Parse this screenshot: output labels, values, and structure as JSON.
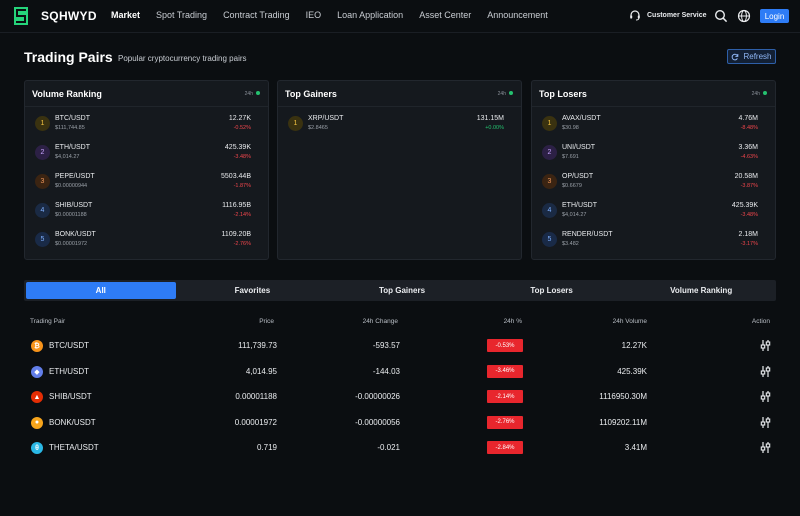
{
  "brand": {
    "name": "SQHWYD",
    "accent": "#2e7cf6"
  },
  "nav": {
    "links": [
      "Market",
      "Spot Trading",
      "Contract Trading",
      "IEO",
      "Loan Application",
      "Asset Center",
      "Announcement"
    ],
    "customer_service": "Customer Service",
    "login_label": "Login"
  },
  "header": {
    "title": "Trading Pairs",
    "subtitle": "Popular cryptocurrency trading pairs",
    "refresh_label": "Refresh"
  },
  "cards": [
    {
      "title": "Volume Ranking",
      "period": "24h",
      "items": [
        {
          "rank": "1",
          "symbol": "BTC/USDT",
          "price": "$111,744.85",
          "value": "12.27K",
          "change": "-0.52%",
          "dir": "neg"
        },
        {
          "rank": "2",
          "symbol": "ETH/USDT",
          "price": "$4,014.27",
          "value": "425.39K",
          "change": "-3.48%",
          "dir": "neg"
        },
        {
          "rank": "3",
          "symbol": "PEPE/USDT",
          "price": "$0.00000944",
          "value": "5503.44B",
          "change": "-1.87%",
          "dir": "neg"
        },
        {
          "rank": "4",
          "symbol": "SHIB/USDT",
          "price": "$0.00001188",
          "value": "1116.95B",
          "change": "-2.14%",
          "dir": "neg"
        },
        {
          "rank": "5",
          "symbol": "BONK/USDT",
          "price": "$0.00001972",
          "value": "1109.20B",
          "change": "-2.76%",
          "dir": "neg"
        }
      ]
    },
    {
      "title": "Top Gainers",
      "period": "24h",
      "items": [
        {
          "rank": "1",
          "symbol": "XRP/USDT",
          "price": "$2.8465",
          "value": "131.15M",
          "change": "+0.00%",
          "dir": "pos"
        }
      ]
    },
    {
      "title": "Top Losers",
      "period": "24h",
      "items": [
        {
          "rank": "1",
          "symbol": "AVAX/USDT",
          "price": "$30.98",
          "value": "4.76M",
          "change": "-8.48%",
          "dir": "neg"
        },
        {
          "rank": "2",
          "symbol": "UNI/USDT",
          "price": "$7.691",
          "value": "3.36M",
          "change": "-4.63%",
          "dir": "neg"
        },
        {
          "rank": "3",
          "symbol": "OP/USDT",
          "price": "$0.6679",
          "value": "20.58M",
          "change": "-3.87%",
          "dir": "neg"
        },
        {
          "rank": "4",
          "symbol": "ETH/USDT",
          "price": "$4,014.27",
          "value": "425.39K",
          "change": "-3.48%",
          "dir": "neg"
        },
        {
          "rank": "5",
          "symbol": "RENDER/USDT",
          "price": "$3.482",
          "value": "2.18M",
          "change": "-3.17%",
          "dir": "neg"
        }
      ]
    }
  ],
  "tabs": [
    "All",
    "Favorites",
    "Top Gainers",
    "Top Losers",
    "Volume Ranking"
  ],
  "table": {
    "headers": [
      "Trading Pair",
      "Price",
      "24h Change",
      "24h %",
      "24h Volume",
      "Action"
    ],
    "rows": [
      {
        "pair": "BTC/USDT",
        "price": "111,739.73",
        "change": "-593.57",
        "pct": "-0.53%",
        "volume": "12.27K",
        "coin_color": "#f7931a",
        "coin_glyph": "₿"
      },
      {
        "pair": "ETH/USDT",
        "price": "4,014.95",
        "change": "-144.03",
        "pct": "-3.46%",
        "volume": "425.39K",
        "coin_color": "#627eea",
        "coin_glyph": "◆"
      },
      {
        "pair": "SHIB/USDT",
        "price": "0.00001188",
        "change": "-0.00000026",
        "pct": "-2.14%",
        "volume": "1116950.30M",
        "coin_color": "#e42d04",
        "coin_glyph": "▲"
      },
      {
        "pair": "BONK/USDT",
        "price": "0.00001972",
        "change": "-0.00000056",
        "pct": "-2.76%",
        "volume": "1109202.11M",
        "coin_color": "#f8a51c",
        "coin_glyph": "●"
      },
      {
        "pair": "THETA/USDT",
        "price": "0.719",
        "change": "-0.021",
        "pct": "-2.84%",
        "volume": "3.41M",
        "coin_color": "#2ab8e6",
        "coin_glyph": "θ"
      }
    ]
  }
}
